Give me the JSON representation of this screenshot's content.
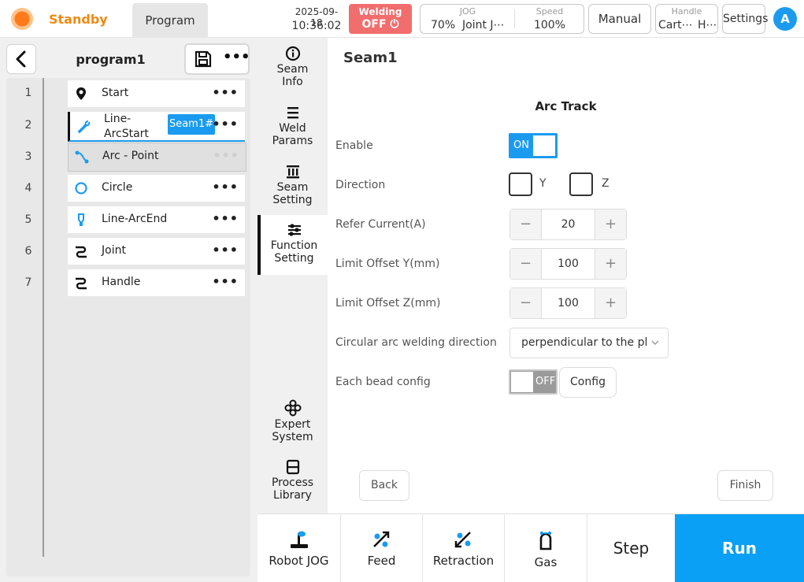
{
  "topbar": {
    "status": "Standby",
    "tab": "Program",
    "date": "2025-09-18",
    "time": "10:36:02",
    "welding_label": "Welding",
    "welding_state": "OFF",
    "jog_label": "JOG",
    "jog_value1": "70%",
    "jog_value2": "Joint J⋯",
    "speed_label": "Speed",
    "speed_value": "100%",
    "mode": "Manual",
    "handle_label": "Handle",
    "handle_value1": "Cart⋯",
    "handle_value2": "H⋯",
    "settings": "Settings",
    "avatar": "A"
  },
  "program": {
    "name": "program1",
    "rows": [
      {
        "num": "1",
        "label": "Start",
        "icon": "location-pin-icon"
      },
      {
        "num": "2",
        "label": "Line-\nArcStart",
        "icon": "wrench-icon",
        "chip": "Seam1#"
      },
      {
        "num": "3",
        "label": "Arc - Point",
        "icon": "arc-point-icon"
      },
      {
        "num": "4",
        "label": "Circle",
        "icon": "circle-icon"
      },
      {
        "num": "5",
        "label": "Line-ArcEnd",
        "icon": "torch-icon"
      },
      {
        "num": "6",
        "label": "Joint",
        "icon": "joint-icon"
      },
      {
        "num": "7",
        "label": "Handle",
        "icon": "handle-icon"
      }
    ],
    "more": "•••"
  },
  "subtabs": {
    "seam_info": [
      "Seam",
      "Info"
    ],
    "weld_params": [
      "Weld",
      "Params"
    ],
    "seam_setting": [
      "Seam",
      "Setting"
    ],
    "function_setting": [
      "Function",
      "Setting"
    ],
    "expert_system": [
      "Expert",
      "System"
    ],
    "process_library": [
      "Process",
      "Library"
    ]
  },
  "main": {
    "seam_title": "Seam1",
    "section": "Arc Track",
    "enable_label": "Enable",
    "enable_state": "ON",
    "direction_label": "Direction",
    "dir_y": "Y",
    "dir_z": "Z",
    "refer_current_label": "Refer Current(A)",
    "refer_current": "20",
    "limit_y_label": "Limit Offset Y(mm)",
    "limit_y": "100",
    "limit_z_label": "Limit Offset Z(mm)",
    "limit_z": "100",
    "circ_dir_label": "Circular arc welding direction",
    "circ_dir_value": "perpendicular to the plane",
    "bead_label": "Each bead config",
    "bead_state": "OFF",
    "config": "Config",
    "back": "Back",
    "finish": "Finish",
    "minus": "−",
    "plus": "+"
  },
  "actions": {
    "robot_jog": "Robot JOG",
    "feed": "Feed",
    "retraction": "Retraction",
    "gas": "Gas",
    "step": "Step",
    "run": "Run"
  },
  "colors": {
    "accent": "#0aa0f5",
    "status_orange": "#f08a14",
    "welding_red": "#f26d6d"
  }
}
